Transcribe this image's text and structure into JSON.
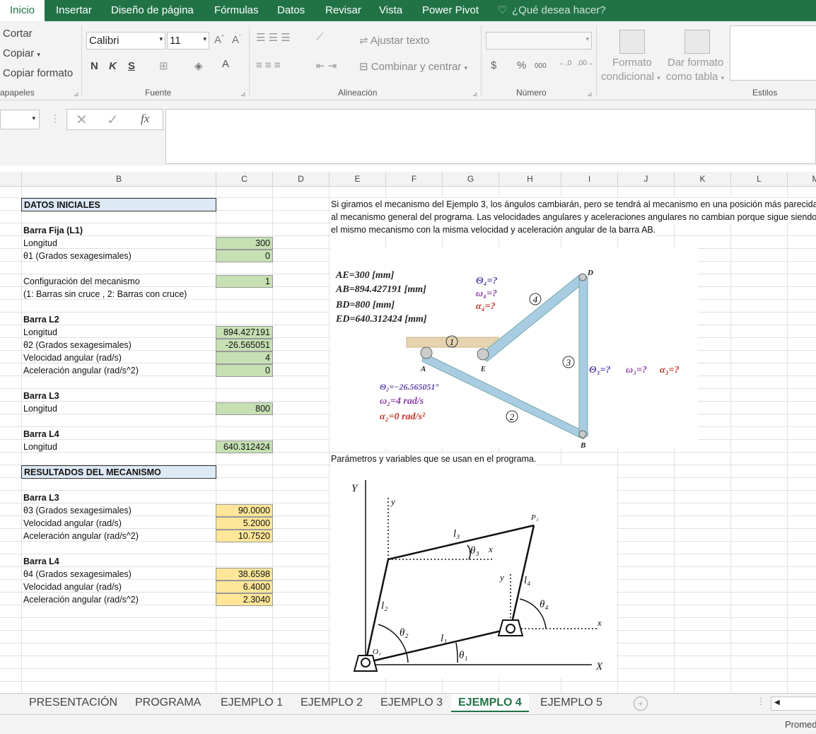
{
  "menu": {
    "tabs": [
      "Inicio",
      "Insertar",
      "Diseño de página",
      "Fórmulas",
      "Datos",
      "Revisar",
      "Vista",
      "Power Pivot"
    ],
    "tell_me": "¿Qué desea hacer?"
  },
  "ribbon": {
    "clipboard": {
      "cut": "Cortar",
      "copy": "Copiar",
      "format_painter": "Copiar formato",
      "group": "apapeles"
    },
    "font": {
      "name": "Calibri",
      "size": "11",
      "bold": "N",
      "italic": "K",
      "underline": "S",
      "group": "Fuente"
    },
    "alignment": {
      "wrap": "Ajustar texto",
      "merge": "Combinar y centrar",
      "group": "Alineación"
    },
    "number": {
      "currency": "$",
      "percent": "%",
      "thousands": "000",
      "group": "Número"
    },
    "styles": {
      "cond_format_1": "Formato",
      "cond_format_2": "condicional",
      "table_1": "Dar formato",
      "table_2": "como tabla",
      "group": "Estilos"
    }
  },
  "formula_bar": {
    "fx": "fx"
  },
  "columns": [
    "B",
    "C",
    "D",
    "E",
    "F",
    "G",
    "H",
    "I",
    "J",
    "K",
    "L",
    "M"
  ],
  "sheet": {
    "datos_iniciales": "DATOS INICIALES",
    "barra_fija": "Barra Fija (L1)",
    "longitud": "Longitud",
    "theta1": "θ1 (Grados sexagesimales)",
    "config": "Configuración del mecanismo",
    "config_note": "(1: Barras sin cruce , 2: Barras con cruce)",
    "barra_l2": "Barra L2",
    "theta2": "θ2 (Grados sexagesimales)",
    "vel": "Velocidad angular (rad/s)",
    "acel": "Aceleración angular (rad/s^2)",
    "barra_l3": "Barra L3",
    "barra_l4": "Barra L4",
    "resultados": "RESULTADOS DEL MECANISMO",
    "theta3": "θ3 (Grados sexagesimales)",
    "theta4": "θ4 (Grados sexagesimales)",
    "v_l1_long": "300",
    "v_l1_theta": "0",
    "v_config": "1",
    "v_l2_long": "894.427191",
    "v_l2_theta": "-26.565051",
    "v_l2_vel": "4",
    "v_l2_acel": "0",
    "v_l3_long": "800",
    "v_l4_long": "640.312424",
    "r_theta3": "90.0000",
    "r_vel3": "5.2000",
    "r_acel3": "10.7520",
    "r_theta4": "38.6598",
    "r_vel4": "6.4000",
    "r_acel4": "2.3040",
    "desc1": "Si giramos el mecanismo del Ejemplo 3, los ángulos cambiarán, pero se tendrá al mecanismo en una posición más parecida",
    "desc2": "al mecanismo general del programa. Las velocidades angulares y aceleraciones angulares no cambian porque sigue siendo",
    "desc3": "el mismo mecanismo con la misma velocidad y aceleración angular de la barra AB.",
    "params": "Parámetros y variables que se usan en el programa."
  },
  "figure1": {
    "ae": "AE=300  [mm]",
    "ab": "AB=894.427191  [mm]",
    "bd": "BD=800  [mm]",
    "ed": "ED=640.312424  [mm]",
    "t4": "Θ₄=?",
    "w4": "ω₄=?",
    "a4": "α₄=?",
    "t3": "Θ₃=?",
    "w3": "ω₃=?",
    "a3": "α₃=?",
    "t2": "Θ₂=−26.565051°",
    "w2": "ω₂=4  rad/s",
    "a2": "α₂=0  rad/s²",
    "pD": "D",
    "pA": "A",
    "pB": "B",
    "pE": "E",
    "n1": "1",
    "n2": "2",
    "n3": "3",
    "n4": "4"
  },
  "figure2": {
    "Y": "Y",
    "X": "X",
    "y": "y",
    "x": "x",
    "P1": "P₁",
    "O1": "O₁",
    "l1": "l₁",
    "l2": "l₂",
    "l3": "l₃",
    "l4": "l₄",
    "th1": "θ₁",
    "th2": "θ₂",
    "th3": "θ₃",
    "th4": "θ₄",
    "x2": "x",
    "y2": "y"
  },
  "sheet_tabs": [
    "PRESENTACIÓN",
    "PROGRAMA",
    "EJEMPLO 1",
    "EJEMPLO 2",
    "EJEMPLO 3",
    "EJEMPLO 4",
    "EJEMPLO 5"
  ],
  "status": {
    "right": "Promed"
  }
}
